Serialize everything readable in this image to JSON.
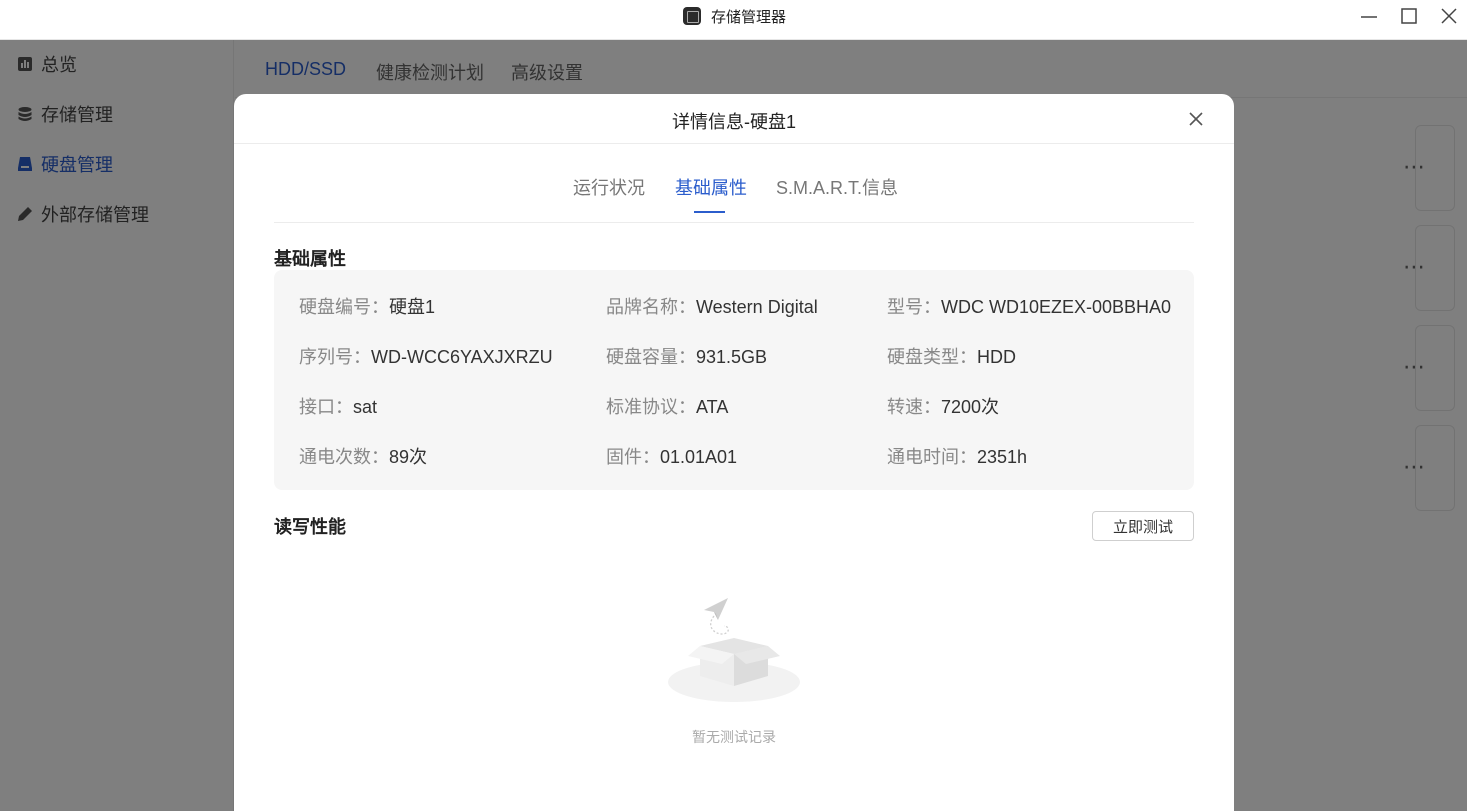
{
  "window": {
    "title": "存储管理器",
    "controls": [
      "minimize-icon",
      "maximize-icon",
      "close-icon"
    ]
  },
  "sidebar": {
    "items": [
      {
        "label": "总览",
        "icon": "chart-icon"
      },
      {
        "label": "存储管理",
        "icon": "database-icon"
      },
      {
        "label": "硬盘管理",
        "icon": "disk-icon",
        "active": true
      },
      {
        "label": "外部存储管理",
        "icon": "pencil-icon"
      }
    ]
  },
  "main": {
    "tabs": [
      {
        "label": "HDD/SSD",
        "active": true
      },
      {
        "label": "健康检测计划"
      },
      {
        "label": "高级设置"
      }
    ],
    "more_label": "⋯"
  },
  "modal": {
    "title": "详情信息-硬盘1",
    "tabs": [
      {
        "label": "运行状况"
      },
      {
        "label": "基础属性",
        "active": true
      },
      {
        "label": "S.M.A.R.T.信息"
      }
    ],
    "basic_title": "基础属性",
    "props": [
      {
        "key": "硬盘编号：",
        "value": "硬盘1"
      },
      {
        "key": "品牌名称：",
        "value": "Western Digital"
      },
      {
        "key": "型号：",
        "value": "WDC WD10EZEX-00BBHA0"
      },
      {
        "key": "序列号：",
        "value": "WD-WCC6YAXJXRZU"
      },
      {
        "key": "硬盘容量：",
        "value": "931.5GB"
      },
      {
        "key": "硬盘类型：",
        "value": "HDD"
      },
      {
        "key": "接口：",
        "value": "sat"
      },
      {
        "key": "标准协议：",
        "value": "ATA"
      },
      {
        "key": "转速：",
        "value": "7200次"
      },
      {
        "key": "通电次数：",
        "value": "89次"
      },
      {
        "key": "固件：",
        "value": "01.01A01"
      },
      {
        "key": "通电时间：",
        "value": "2351h"
      }
    ],
    "rw_title": "读写性能",
    "test_button": "立即测试",
    "empty_text": "暂无测试记录"
  },
  "colors": {
    "accent": "#2b5dcc",
    "overlay": "rgba(0,0,0,0.5)"
  }
}
